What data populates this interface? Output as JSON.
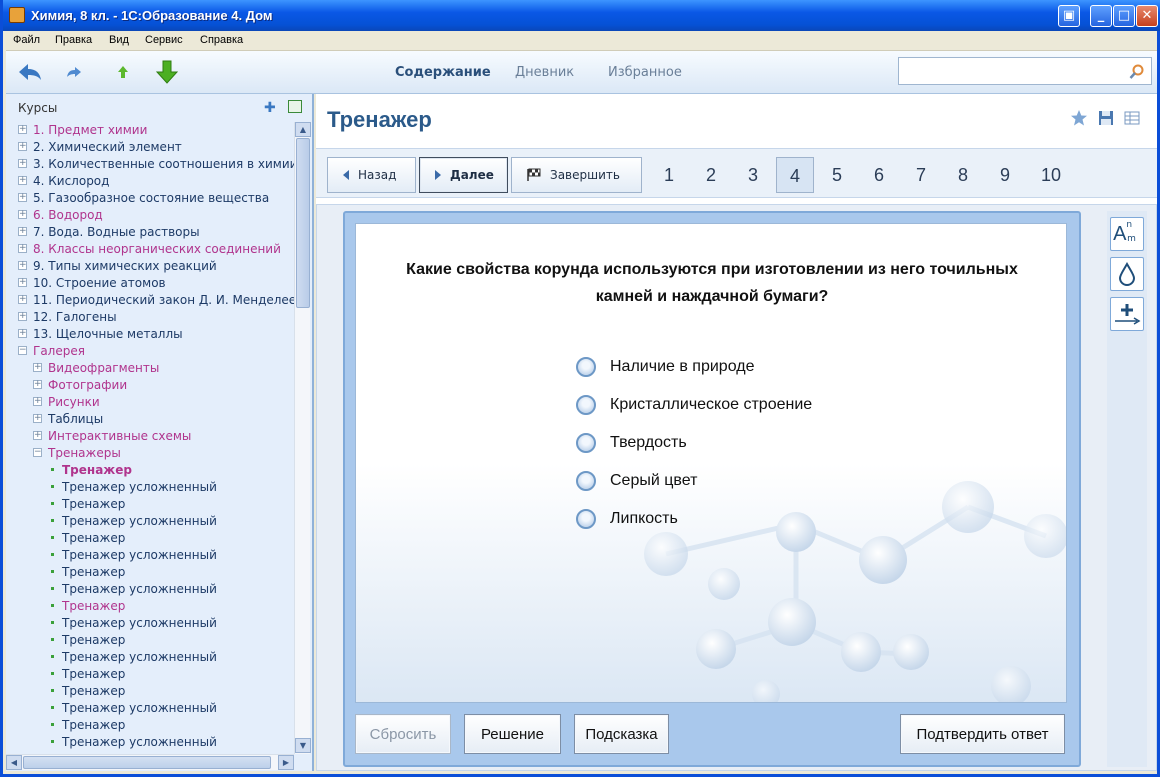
{
  "window": {
    "title": "Химия, 8 кл. - 1С:Образование 4. Дом"
  },
  "menu": [
    "Файл",
    "Правка",
    "Вид",
    "Сервис",
    "Справка"
  ],
  "top_tabs": [
    {
      "label": "Содержание",
      "active": true
    },
    {
      "label": "Дневник",
      "active": false
    },
    {
      "label": "Избранное",
      "active": false
    }
  ],
  "search": {
    "value": "",
    "placeholder": ""
  },
  "sidebar": {
    "header": "Курсы",
    "items": [
      {
        "label": "1. Предмет химии",
        "level": 0,
        "kind": "plus",
        "style": "pink"
      },
      {
        "label": "2. Химический элемент",
        "level": 0,
        "kind": "plus",
        "style": "blue"
      },
      {
        "label": "3. Количественные соотношения в химии",
        "level": 0,
        "kind": "plus",
        "style": "blue"
      },
      {
        "label": "4. Кислород",
        "level": 0,
        "kind": "plus",
        "style": "blue"
      },
      {
        "label": "5. Газообразное состояние вещества",
        "level": 0,
        "kind": "plus",
        "style": "blue"
      },
      {
        "label": "6. Водород",
        "level": 0,
        "kind": "plus",
        "style": "pink"
      },
      {
        "label": "7. Вода. Водные растворы",
        "level": 0,
        "kind": "plus",
        "style": "blue"
      },
      {
        "label": "8. Классы неорганических соединений",
        "level": 0,
        "kind": "plus",
        "style": "pink"
      },
      {
        "label": "9. Типы химических реакций",
        "level": 0,
        "kind": "plus",
        "style": "blue"
      },
      {
        "label": "10. Строение атомов",
        "level": 0,
        "kind": "plus",
        "style": "blue"
      },
      {
        "label": "11. Периодический закон Д. И. Менделеев",
        "level": 0,
        "kind": "plus",
        "style": "blue"
      },
      {
        "label": "12. Галогены",
        "level": 0,
        "kind": "plus",
        "style": "blue"
      },
      {
        "label": "13. Щелочные металлы",
        "level": 0,
        "kind": "plus",
        "style": "blue"
      },
      {
        "label": "Галерея",
        "level": 0,
        "kind": "minus",
        "style": "pink"
      },
      {
        "label": "Видеофрагменты",
        "level": 1,
        "kind": "plus",
        "style": "pink"
      },
      {
        "label": "Фотографии",
        "level": 1,
        "kind": "plus",
        "style": "pink"
      },
      {
        "label": "Рисунки",
        "level": 1,
        "kind": "plus",
        "style": "pink"
      },
      {
        "label": "Таблицы",
        "level": 1,
        "kind": "plus",
        "style": "blue"
      },
      {
        "label": "Интерактивные схемы",
        "level": 1,
        "kind": "plus",
        "style": "pink"
      },
      {
        "label": "Тренажеры",
        "level": 1,
        "kind": "minus",
        "style": "pink"
      },
      {
        "label": "Тренажер",
        "level": 2,
        "kind": "dot",
        "style": "bold"
      },
      {
        "label": "Тренажер усложненный",
        "level": 2,
        "kind": "dot",
        "style": "blue"
      },
      {
        "label": "Тренажер",
        "level": 2,
        "kind": "dot",
        "style": "blue"
      },
      {
        "label": "Тренажер усложненный",
        "level": 2,
        "kind": "dot",
        "style": "blue"
      },
      {
        "label": "Тренажер",
        "level": 2,
        "kind": "dot",
        "style": "blue"
      },
      {
        "label": "Тренажер усложненный",
        "level": 2,
        "kind": "dot",
        "style": "blue"
      },
      {
        "label": "Тренажер",
        "level": 2,
        "kind": "dot",
        "style": "blue"
      },
      {
        "label": "Тренажер усложненный",
        "level": 2,
        "kind": "dot",
        "style": "blue"
      },
      {
        "label": "Тренажер",
        "level": 2,
        "kind": "dot",
        "style": "pink"
      },
      {
        "label": "Тренажер усложненный",
        "level": 2,
        "kind": "dot",
        "style": "blue"
      },
      {
        "label": "Тренажер",
        "level": 2,
        "kind": "dot",
        "style": "blue"
      },
      {
        "label": "Тренажер усложненный",
        "level": 2,
        "kind": "dot",
        "style": "blue"
      },
      {
        "label": "Тренажер",
        "level": 2,
        "kind": "dot",
        "style": "blue"
      },
      {
        "label": "Тренажер",
        "level": 2,
        "kind": "dot",
        "style": "blue"
      },
      {
        "label": "Тренажер усложненный",
        "level": 2,
        "kind": "dot",
        "style": "blue"
      },
      {
        "label": "Тренажер",
        "level": 2,
        "kind": "dot",
        "style": "blue"
      },
      {
        "label": "Тренажер усложненный",
        "level": 2,
        "kind": "dot",
        "style": "blue"
      }
    ]
  },
  "main": {
    "title": "Тренажер",
    "nav": {
      "back": "Назад",
      "next": "Далее",
      "finish": "Завершить"
    },
    "pages": [
      "1",
      "2",
      "3",
      "4",
      "5",
      "6",
      "7",
      "8",
      "9",
      "10"
    ],
    "current_page": "4",
    "question": "Какие свойства корунда используются при изготовлении из него точильных камней и наждачной бумаги?",
    "options": [
      "Наличие в природе",
      "Кристаллическое строение",
      "Твердость",
      "Серый цвет",
      "Липкость"
    ],
    "buttons": {
      "reset": "Сбросить",
      "solution": "Решение",
      "hint": "Подсказка",
      "confirm": "Подтвердить ответ"
    },
    "tools": {
      "font": "A",
      "sup": "n",
      "sub": "m"
    }
  }
}
